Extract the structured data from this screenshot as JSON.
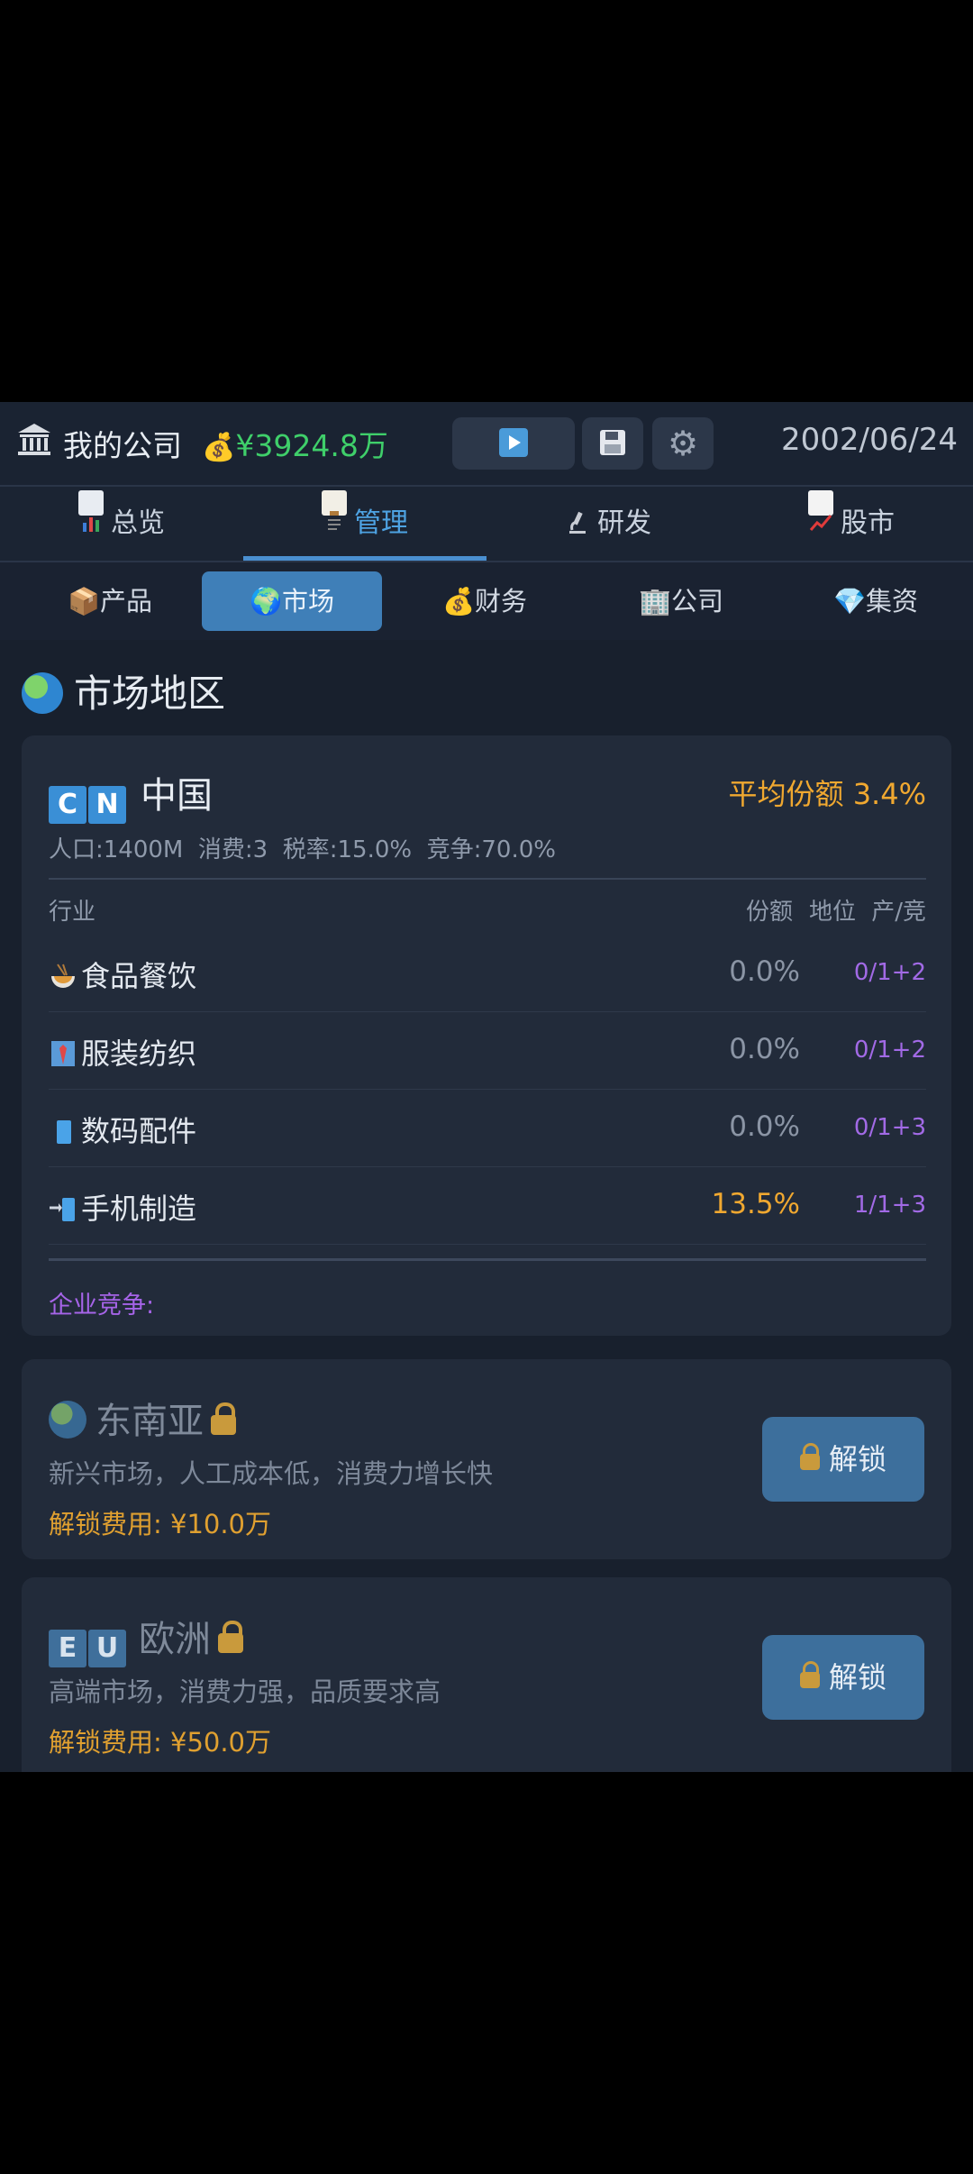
{
  "header": {
    "company_name": "我的公司",
    "money": "¥3924.8万",
    "date": "2002/06/24"
  },
  "main_tabs": [
    {
      "label": "总览",
      "icon": "bar-chart-icon"
    },
    {
      "label": "管理",
      "icon": "clipboard-icon",
      "active": true
    },
    {
      "label": "研发",
      "icon": "microscope-icon"
    },
    {
      "label": "股市",
      "icon": "trend-chart-icon"
    }
  ],
  "sub_tabs": [
    {
      "label": "产品",
      "icon": "package-icon"
    },
    {
      "label": "市场",
      "icon": "globe-icon",
      "active": true
    },
    {
      "label": "财务",
      "icon": "money-bag-icon"
    },
    {
      "label": "公司",
      "icon": "office-building-icon"
    },
    {
      "label": "集资",
      "icon": "gem-icon"
    }
  ],
  "section_title": "市场地区",
  "china": {
    "flag": [
      "C",
      "N"
    ],
    "name": "中国",
    "avg_share": "平均份额 3.4%",
    "stats": "人口:1400M  消费:3  税率:15.0%  竞争:70.0%",
    "headers": {
      "industry": "行业",
      "share": "份额",
      "position": "地位",
      "prod_comp": "产/竞"
    },
    "rows": [
      {
        "name": "食品餐饮",
        "share": "0.0%",
        "pc": "0/1+2",
        "icon": "noodle-bowl-icon"
      },
      {
        "name": "服装纺织",
        "share": "0.0%",
        "pc": "0/1+2",
        "icon": "shirt-icon"
      },
      {
        "name": "数码配件",
        "share": "0.0%",
        "pc": "0/1+3",
        "icon": "phone-icon"
      },
      {
        "name": "手机制造",
        "share": "13.5%",
        "pc": "1/1+3",
        "icon": "mobile-arrow-icon"
      }
    ],
    "competition_label": "企业竞争:"
  },
  "locked_regions": [
    {
      "name": "东南亚",
      "flag_type": "globe",
      "desc": "新兴市场，人工成本低，消费力增长快",
      "cost": "解锁费用: ¥10.0万",
      "button": "解锁"
    },
    {
      "name": "欧洲",
      "flag_type": "letters",
      "flag": [
        "E",
        "U"
      ],
      "desc": "高端市场，消费力强，品质要求高",
      "cost": "解锁费用: ¥50.0万",
      "button": "解锁"
    }
  ]
}
